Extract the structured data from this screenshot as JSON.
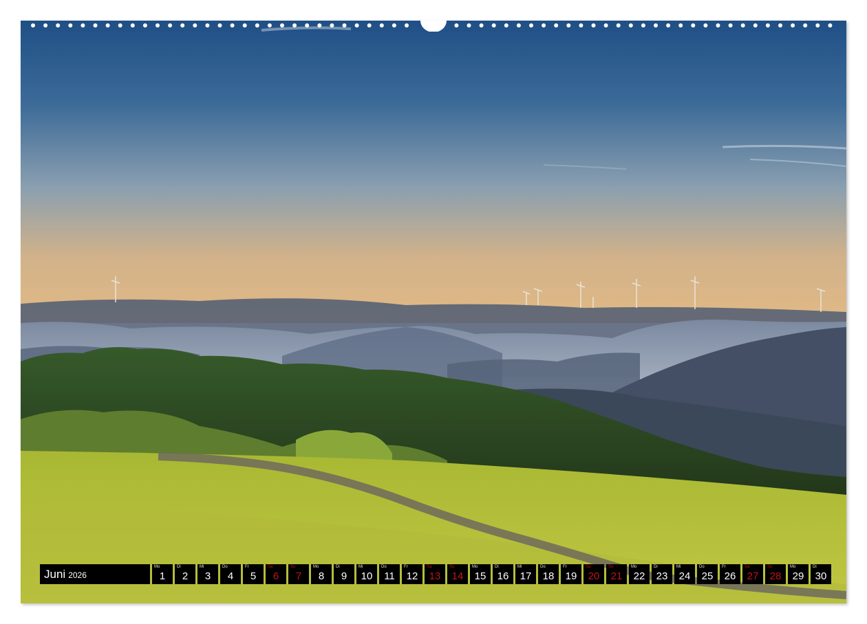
{
  "calendar": {
    "month": "Juni",
    "year": "2026",
    "days": [
      {
        "wd": "Mo",
        "n": "1",
        "weekend": false
      },
      {
        "wd": "Di",
        "n": "2",
        "weekend": false
      },
      {
        "wd": "Mi",
        "n": "3",
        "weekend": false
      },
      {
        "wd": "Do",
        "n": "4",
        "weekend": false
      },
      {
        "wd": "Fr",
        "n": "5",
        "weekend": false
      },
      {
        "wd": "Sa",
        "n": "6",
        "weekend": true
      },
      {
        "wd": "So",
        "n": "7",
        "weekend": true
      },
      {
        "wd": "Mo",
        "n": "8",
        "weekend": false
      },
      {
        "wd": "Di",
        "n": "9",
        "weekend": false
      },
      {
        "wd": "Mi",
        "n": "10",
        "weekend": false
      },
      {
        "wd": "Do",
        "n": "11",
        "weekend": false
      },
      {
        "wd": "Fr",
        "n": "12",
        "weekend": false
      },
      {
        "wd": "Sa",
        "n": "13",
        "weekend": true
      },
      {
        "wd": "So",
        "n": "14",
        "weekend": true
      },
      {
        "wd": "Mo",
        "n": "15",
        "weekend": false
      },
      {
        "wd": "Di",
        "n": "16",
        "weekend": false
      },
      {
        "wd": "Mi",
        "n": "17",
        "weekend": false
      },
      {
        "wd": "Do",
        "n": "18",
        "weekend": false
      },
      {
        "wd": "Fr",
        "n": "19",
        "weekend": false
      },
      {
        "wd": "Sa",
        "n": "20",
        "weekend": true
      },
      {
        "wd": "So",
        "n": "21",
        "weekend": true
      },
      {
        "wd": "Mo",
        "n": "22",
        "weekend": false
      },
      {
        "wd": "Di",
        "n": "23",
        "weekend": false
      },
      {
        "wd": "Mi",
        "n": "24",
        "weekend": false
      },
      {
        "wd": "Do",
        "n": "25",
        "weekend": false
      },
      {
        "wd": "Fr",
        "n": "26",
        "weekend": false
      },
      {
        "wd": "Sa",
        "n": "27",
        "weekend": true
      },
      {
        "wd": "So",
        "n": "28",
        "weekend": true
      },
      {
        "wd": "Mo",
        "n": "29",
        "weekend": false
      },
      {
        "wd": "Di",
        "n": "30",
        "weekend": false
      }
    ]
  },
  "photo": {
    "icon": "landscape-photo",
    "colors": {
      "sky_top": "#2a5f96",
      "sky_mid": "#8fa3b6",
      "horizon": "#dcb98a",
      "meadow": "#b4c236",
      "forest": "#2f4a22",
      "weekend_red": "#c0141c"
    }
  }
}
